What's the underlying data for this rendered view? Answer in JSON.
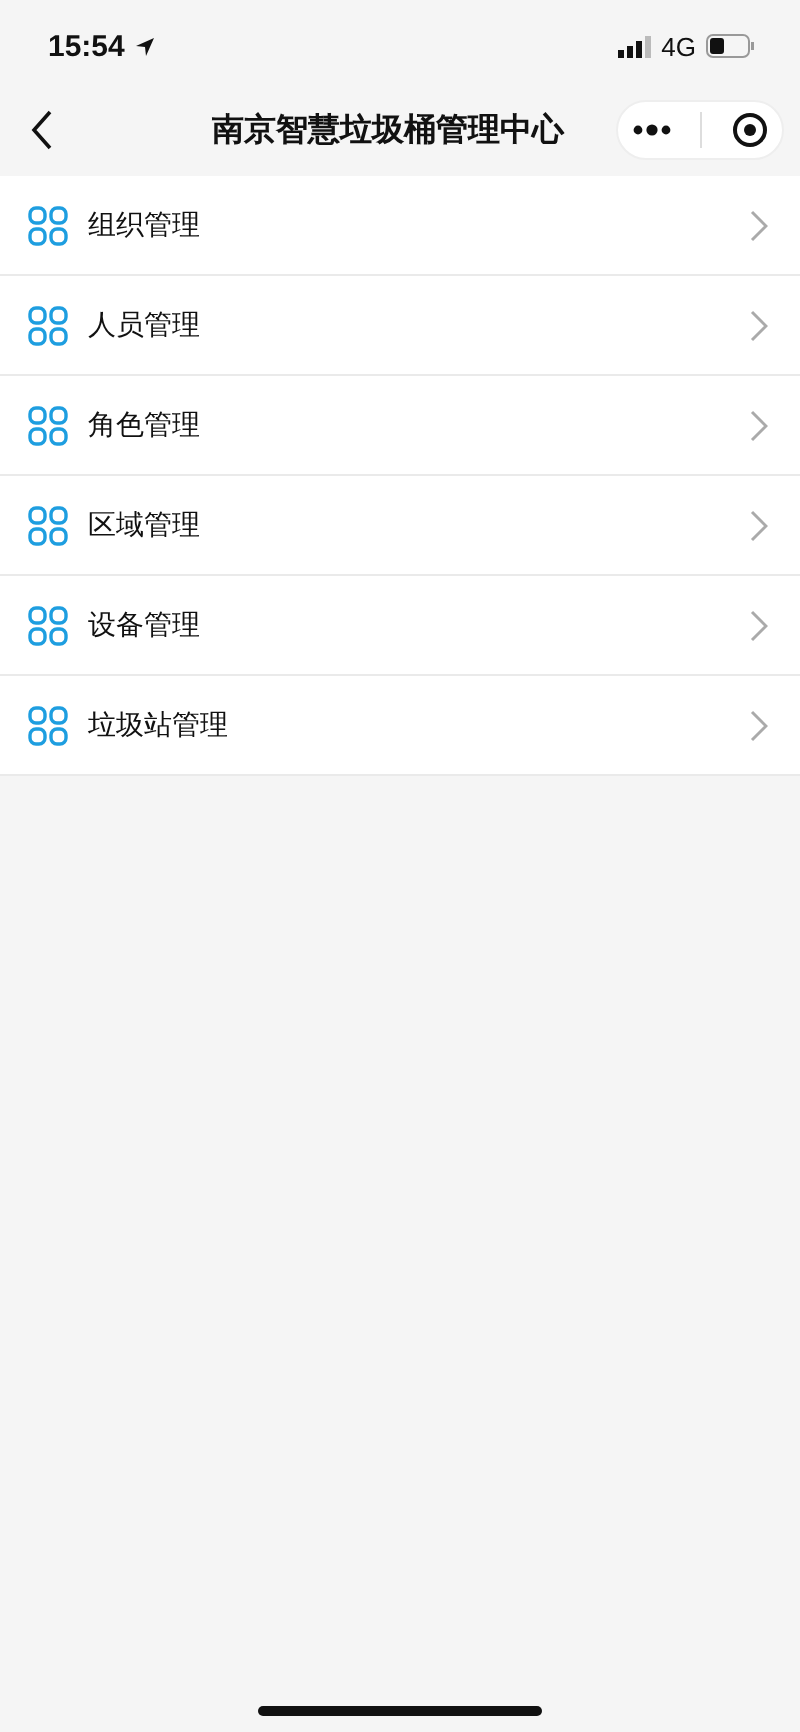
{
  "status_bar": {
    "time": "15:54",
    "network": "4G"
  },
  "nav_bar": {
    "title": "南京智慧垃圾桶管理中心"
  },
  "menu": [
    {
      "label": "组织管理"
    },
    {
      "label": "人员管理"
    },
    {
      "label": "角色管理"
    },
    {
      "label": "区域管理"
    },
    {
      "label": "设备管理"
    },
    {
      "label": "垃圾站管理"
    }
  ]
}
